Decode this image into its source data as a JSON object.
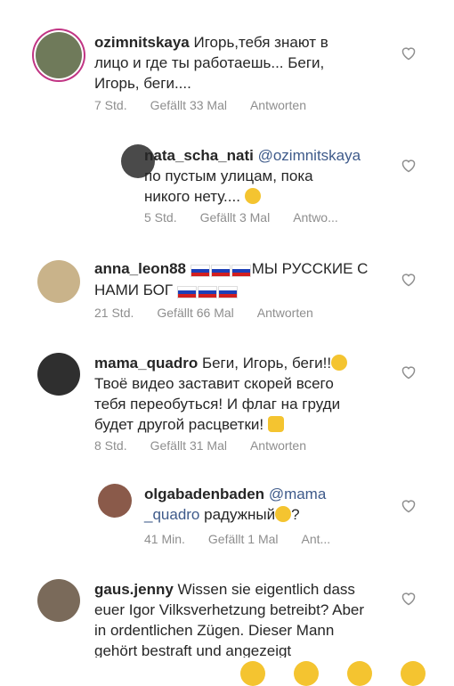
{
  "comments": [
    {
      "username": "ozimnitskaya",
      "text_lines": [
        "Игорь,тебя знают в",
        "лицо и где ты работаешь... Беги,",
        "Игорь, беги...."
      ],
      "time": "7 Std.",
      "likes": "Gefällt 33 Mal",
      "reply": "Antworten"
    },
    {
      "username": "nata_scha_nati",
      "mention": "@ozimnitskaya",
      "text_lines": [
        "по пустым улицам, пока",
        "никого нету...."
      ],
      "time": "5 Std.",
      "likes": "Gefällt 3 Mal",
      "reply": "Antwo..."
    },
    {
      "username": "anna_leon88",
      "text_lines": [
        "МЫ РУССКИЕ С",
        "НАМИ БОГ"
      ],
      "time": "21 Std.",
      "likes": "Gefällt 66 Mal",
      "reply": "Antworten"
    },
    {
      "username": "mama_quadro",
      "text_lines": [
        "Беги, Игорь, беги!!",
        "Твоё видео заставит скорей всего",
        "тебя переобуться! И флаг на груди",
        "будет другой расцветки!"
      ],
      "time": "8 Std.",
      "likes": "Gefällt 31 Mal",
      "reply": "Antworten"
    },
    {
      "username": "olgabadenbaden",
      "mention_lines": [
        "@mama",
        "_quadro"
      ],
      "text_lines": [
        "радужный",
        "?"
      ],
      "time": "41 Min.",
      "likes": "Gefällt 1 Mal",
      "reply": "Ant..."
    },
    {
      "username": "gaus.jenny",
      "text_lines": [
        "Wissen sie eigentlich dass",
        "euer Igor Vilksverhetzung betreibt? Aber",
        "in ordentlichen Zügen. Dieser Mann",
        "gehört bestraft und angezeigt"
      ]
    }
  ]
}
